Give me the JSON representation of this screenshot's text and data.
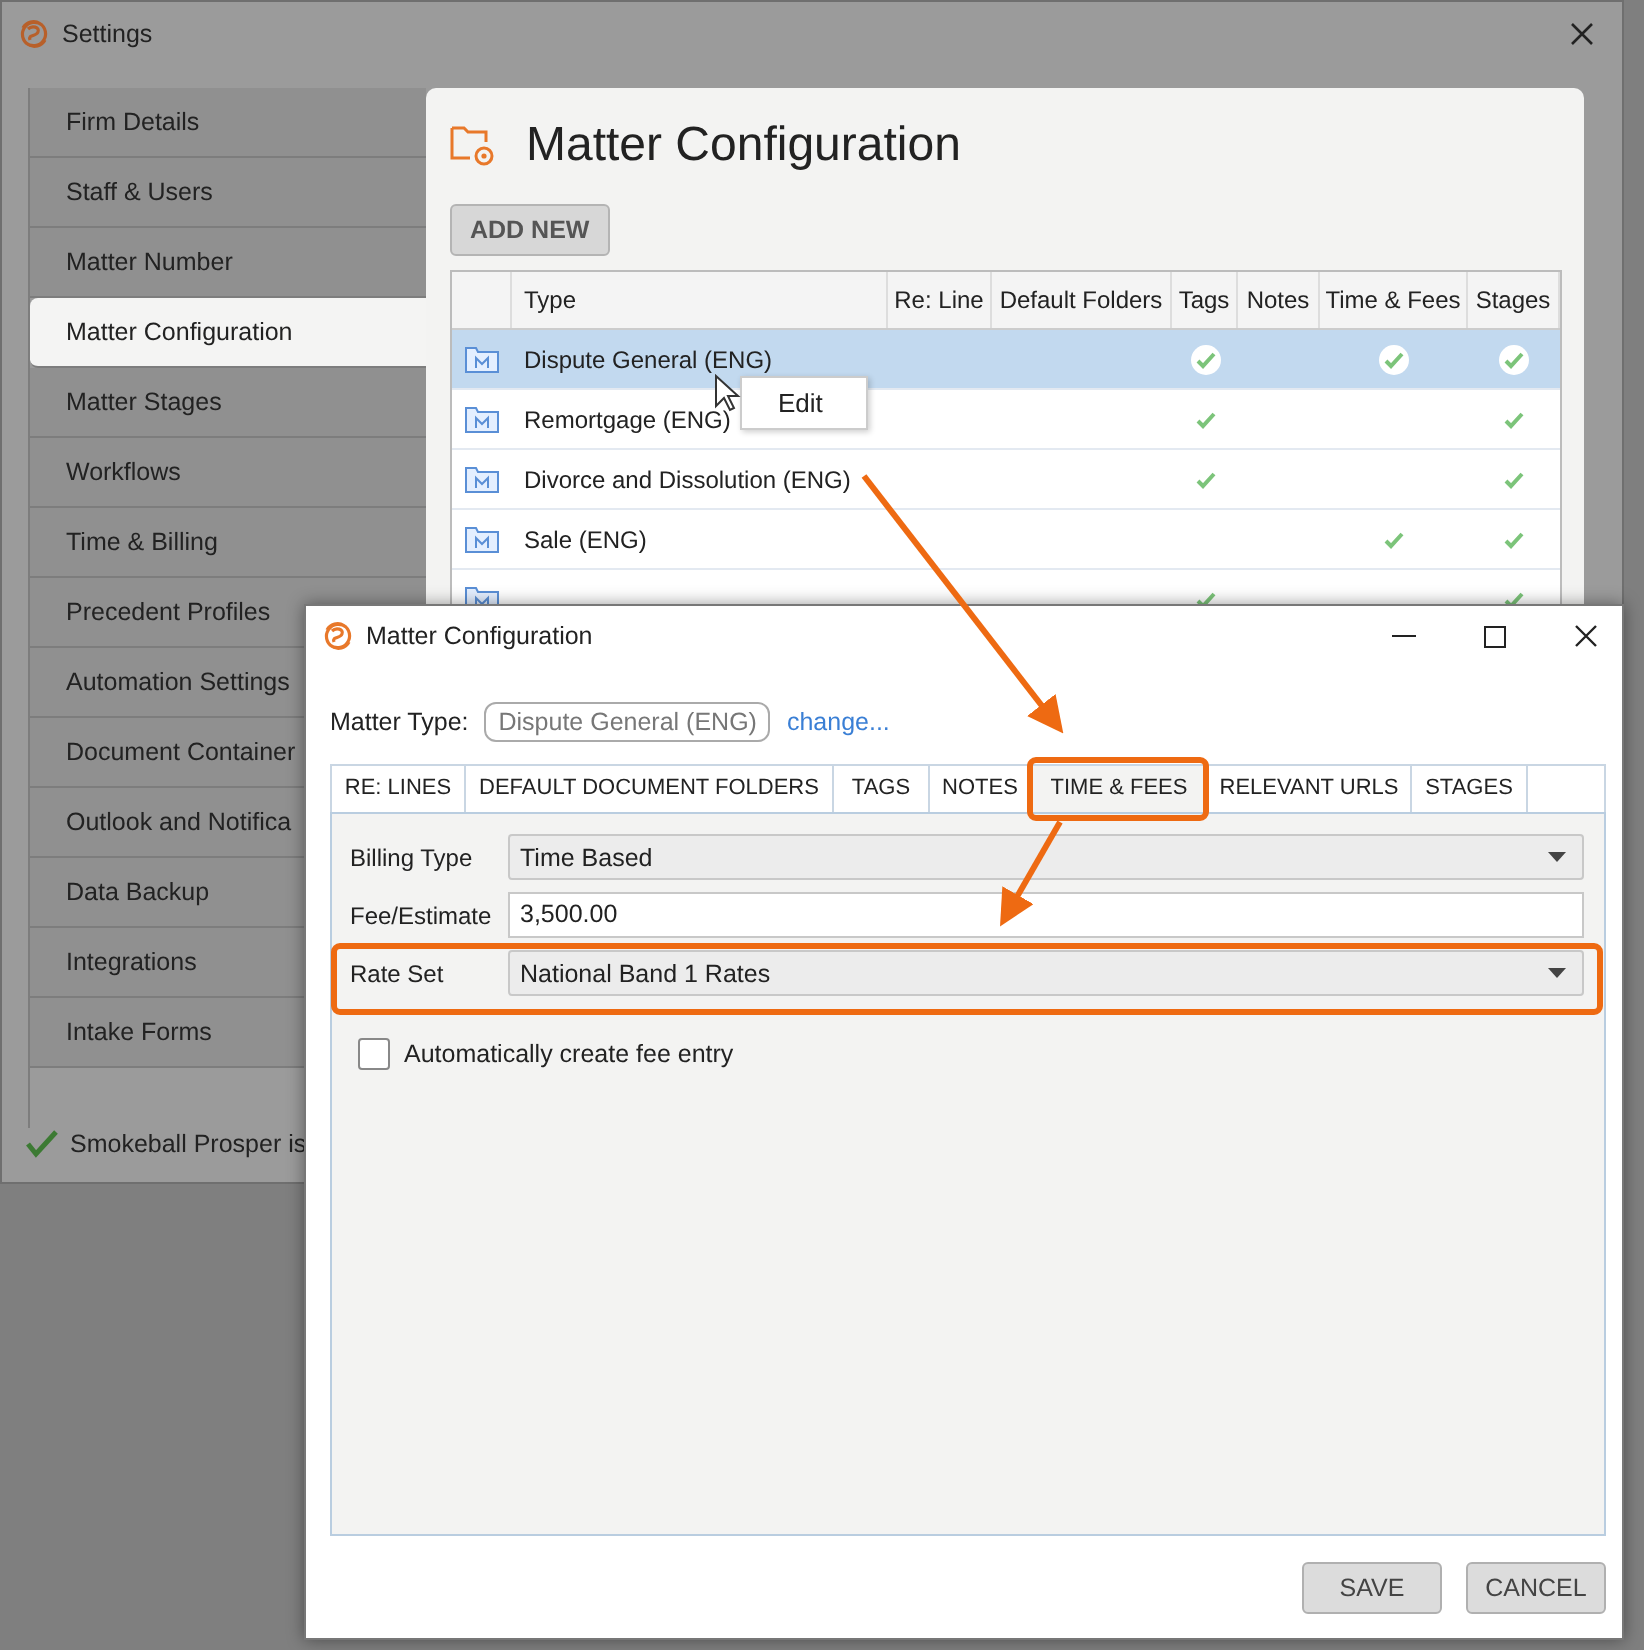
{
  "settings_window": {
    "title": "Settings",
    "sidebar": {
      "items": [
        {
          "label": "Firm Details",
          "selected": false
        },
        {
          "label": "Staff & Users",
          "selected": false
        },
        {
          "label": "Matter Number",
          "selected": false
        },
        {
          "label": "Matter Configuration",
          "selected": true
        },
        {
          "label": "Matter Stages",
          "selected": false
        },
        {
          "label": "Workflows",
          "selected": false
        },
        {
          "label": "Time & Billing",
          "selected": false
        },
        {
          "label": "Precedent Profiles",
          "selected": false
        },
        {
          "label": "Automation Settings",
          "selected": false
        },
        {
          "label": "Document Container",
          "selected": false
        },
        {
          "label": "Outlook and Notifica",
          "selected": false
        },
        {
          "label": "Data Backup",
          "selected": false
        },
        {
          "label": "Integrations",
          "selected": false
        },
        {
          "label": "Intake Forms",
          "selected": false
        }
      ]
    },
    "status": "Smokeball Prosper is",
    "panel": {
      "title": "Matter Configuration",
      "add_button": "ADD NEW",
      "table": {
        "columns": [
          "Type",
          "Re: Line",
          "Default Folders",
          "Tags",
          "Notes",
          "Time & Fees",
          "Stages"
        ],
        "rows": [
          {
            "type": "Dispute General (ENG)",
            "selected": true,
            "checks": [
              false,
              false,
              true,
              false,
              true,
              true
            ]
          },
          {
            "type": "Remortgage (ENG)",
            "selected": false,
            "checks": [
              false,
              false,
              true,
              false,
              false,
              true
            ]
          },
          {
            "type": "Divorce and Dissolution (ENG)",
            "selected": false,
            "checks": [
              false,
              false,
              true,
              false,
              false,
              true
            ]
          },
          {
            "type": "Sale (ENG)",
            "selected": false,
            "checks": [
              false,
              false,
              false,
              false,
              true,
              true
            ]
          },
          {
            "selected": false,
            "checks": [
              false,
              false,
              true,
              false,
              false,
              true
            ]
          }
        ]
      }
    },
    "context_menu": {
      "items": [
        "Edit"
      ]
    }
  },
  "dialog": {
    "title": "Matter Configuration",
    "matter_type_label": "Matter Type:",
    "matter_type_value": "Dispute General (ENG)",
    "change_link": "change...",
    "tabs": [
      {
        "label": "RE: LINES",
        "selected": false
      },
      {
        "label": "DEFAULT DOCUMENT FOLDERS",
        "selected": false
      },
      {
        "label": "TAGS",
        "selected": false
      },
      {
        "label": "NOTES",
        "selected": false
      },
      {
        "label": "TIME & FEES",
        "selected": true
      },
      {
        "label": "RELEVANT URLS",
        "selected": false
      },
      {
        "label": "STAGES",
        "selected": false
      }
    ],
    "fields": [
      {
        "kind": "select",
        "label": "Billing Type",
        "value": "Time Based"
      },
      {
        "kind": "input",
        "label": "Fee/Estimate",
        "value": "3,500.00"
      },
      {
        "kind": "select",
        "label": "Rate Set",
        "value": "National Band 1 Rates"
      }
    ],
    "checkbox": {
      "label": "Automatically create fee entry",
      "checked": false
    },
    "buttons": [
      "SAVE",
      "CANCEL"
    ]
  }
}
